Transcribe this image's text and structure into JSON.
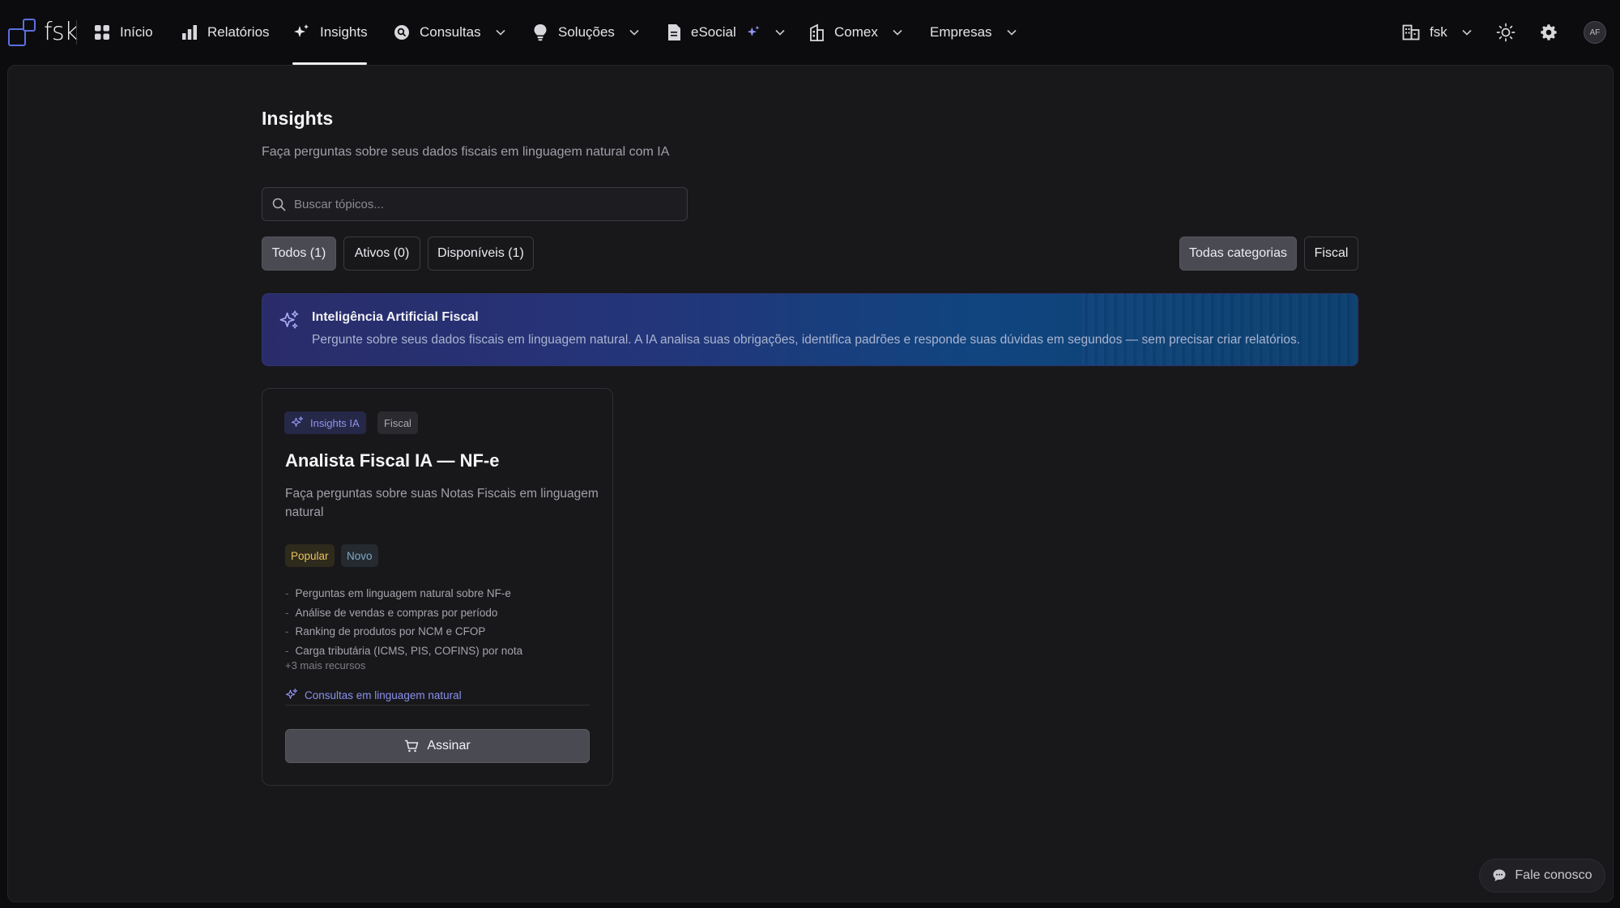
{
  "app": {
    "logo_text": "fsk"
  },
  "nav": {
    "inicio": "Início",
    "relatorios": "Relatórios",
    "insights": "Insights",
    "consultas": "Consultas",
    "solucoes": "Soluções",
    "esocial": "eSocial",
    "comex": "Comex",
    "empresas": "Empresas",
    "active": "Insights"
  },
  "header_right": {
    "company": "fsk",
    "avatar_initials": "AF"
  },
  "page": {
    "title": "Insights",
    "subtitle": "Faça perguntas sobre seus dados fiscais em linguagem natural com IA"
  },
  "search": {
    "placeholder": "Buscar tópicos...",
    "value": ""
  },
  "filters": {
    "status": [
      {
        "label": "Todos (1)",
        "active": true
      },
      {
        "label": "Ativos (0)",
        "active": false
      },
      {
        "label": "Disponíveis (1)",
        "active": false
      }
    ],
    "categories": [
      {
        "label": "Todas categorias",
        "active": true
      },
      {
        "label": "Fiscal",
        "active": false
      }
    ]
  },
  "banner": {
    "title": "Inteligência Artificial Fiscal",
    "text": "Pergunte sobre seus dados fiscais em linguagem natural. A IA analisa suas obrigações, identifica padrões e responde suas dúvidas em segundos — sem precisar criar relatórios."
  },
  "card": {
    "tag_ia": "Insights IA",
    "tag_category": "Fiscal",
    "title": "Analista Fiscal IA — NF-e",
    "description": "Faça perguntas sobre suas Notas Fiscais em linguagem natural",
    "badges": {
      "popular": "Popular",
      "novo": "Novo"
    },
    "features": [
      "Perguntas em linguagem natural sobre NF-e",
      "Análise de vendas e compras por período",
      "Ranking de produtos por NCM e CFOP",
      "Carga tributária (ICMS, PIS, COFINS) por nota"
    ],
    "more": "+3 mais recursos",
    "link": "Consultas em linguagem natural",
    "button": "Assinar"
  },
  "contact": {
    "label": "Fale conosco"
  },
  "colors": {
    "accent": "#5c6fe0",
    "ia_accent": "#8f95ef",
    "popular": "#e6c35a",
    "novo": "#7fa9c8"
  }
}
